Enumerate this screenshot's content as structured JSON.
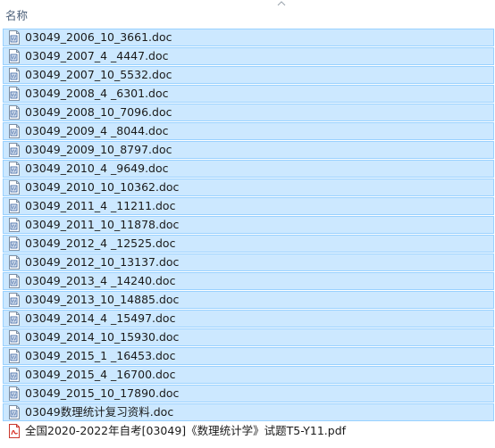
{
  "header": {
    "column_name": "名称"
  },
  "files": [
    {
      "name": "03049_2006_10_3661.doc",
      "icon": "word-doc-icon"
    },
    {
      "name": "03049_2007_4 _4447.doc",
      "icon": "word-doc-icon"
    },
    {
      "name": "03049_2007_10_5532.doc",
      "icon": "word-doc-icon"
    },
    {
      "name": "03049_2008_4 _6301.doc",
      "icon": "word-doc-icon"
    },
    {
      "name": "03049_2008_10_7096.doc",
      "icon": "word-doc-icon"
    },
    {
      "name": "03049_2009_4 _8044.doc",
      "icon": "word-doc-icon"
    },
    {
      "name": "03049_2009_10_8797.doc",
      "icon": "word-doc-icon"
    },
    {
      "name": "03049_2010_4 _9649.doc",
      "icon": "word-doc-icon"
    },
    {
      "name": "03049_2010_10_10362.doc",
      "icon": "word-doc-icon"
    },
    {
      "name": "03049_2011_4 _11211.doc",
      "icon": "word-doc-icon"
    },
    {
      "name": "03049_2011_10_11878.doc",
      "icon": "word-doc-icon"
    },
    {
      "name": "03049_2012_4 _12525.doc",
      "icon": "word-doc-icon"
    },
    {
      "name": "03049_2012_10_13137.doc",
      "icon": "word-doc-icon"
    },
    {
      "name": "03049_2013_4 _14240.doc",
      "icon": "word-doc-icon"
    },
    {
      "name": "03049_2013_10_14885.doc",
      "icon": "word-doc-icon"
    },
    {
      "name": "03049_2014_4 _15497.doc",
      "icon": "word-doc-icon"
    },
    {
      "name": "03049_2014_10_15930.doc",
      "icon": "word-doc-icon"
    },
    {
      "name": "03049_2015_1 _16453.doc",
      "icon": "word-doc-icon"
    },
    {
      "name": "03049_2015_4 _16700.doc",
      "icon": "word-doc-icon"
    },
    {
      "name": "03049_2015_10_17890.doc",
      "icon": "word-doc-icon"
    },
    {
      "name": "03049数理统计复习资料.doc",
      "icon": "word-doc-icon"
    },
    {
      "name": "全国2020-2022年自考[03049]《数理统计学》试题T5-Y11.pdf",
      "icon": "pdf-icon"
    }
  ],
  "colors": {
    "selection_bg": "#cce8ff",
    "selection_border": "#99d1ff",
    "header_text": "#4c607a"
  }
}
